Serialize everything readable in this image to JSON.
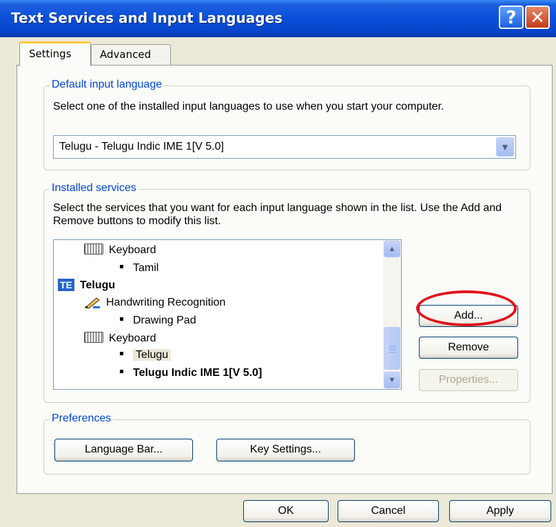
{
  "window": {
    "title": "Text Services and Input Languages",
    "help_button": "?",
    "close_button": "✕"
  },
  "tabs": [
    "Settings",
    "Advanced"
  ],
  "default_input": {
    "legend": "Default input language",
    "description": "Select one of the installed input languages to use when you start your computer.",
    "selected": "Telugu - Telugu Indic IME 1[V 5.0]"
  },
  "installed": {
    "legend": "Installed services",
    "description": "Select the services that you want for each input language shown in the list. Use the Add and Remove buttons to modify this list.",
    "items": {
      "keyboard1": "Keyboard",
      "tamil": "Tamil",
      "telugu_lang_badge": "TE",
      "telugu_lang": "Telugu",
      "handwriting": "Handwriting Recognition",
      "drawing_pad": "Drawing Pad",
      "keyboard2": "Keyboard",
      "telugu_kbd": "Telugu",
      "telugu_ime": "Telugu Indic IME 1[V 5.0]"
    },
    "buttons": {
      "add": "Add...",
      "remove": "Remove",
      "properties": "Properties..."
    }
  },
  "preferences": {
    "legend": "Preferences",
    "language_bar": "Language Bar...",
    "key_settings": "Key Settings..."
  },
  "footer": {
    "ok": "OK",
    "cancel": "Cancel",
    "apply": "Apply"
  },
  "colors": {
    "title_bar": "#0a4fd8",
    "group_label": "#0046d5",
    "callout": "#e0101c",
    "dialog_bg": "#ECE9D8"
  },
  "icons": [
    "help-icon",
    "close-icon",
    "chevron-down-icon",
    "keyboard-icon",
    "pen-icon",
    "language-badge-icon",
    "scroll-up-icon",
    "scroll-down-icon"
  ]
}
